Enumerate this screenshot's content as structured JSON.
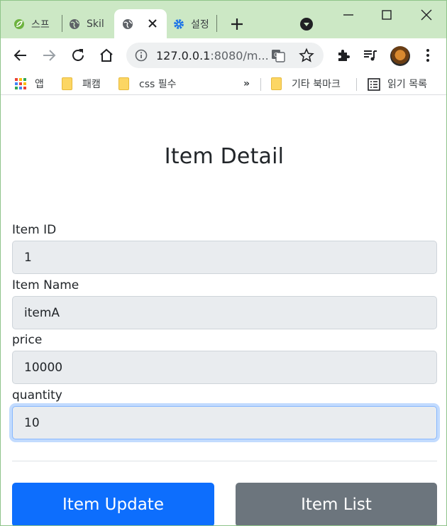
{
  "browser": {
    "tabs": [
      {
        "title": "스프",
        "active": false
      },
      {
        "title": "Skil",
        "active": false
      },
      {
        "title": "",
        "active": true
      },
      {
        "title": "설정",
        "active": false
      }
    ],
    "address": {
      "host": "127.0.0.1",
      "rest": ":8080/m..."
    },
    "bookmarks": [
      {
        "label": "앱",
        "icon": "apps-grid-icon"
      },
      {
        "label": "패캠",
        "icon": "folder-icon"
      },
      {
        "label": "css 필수",
        "icon": "folder-icon"
      },
      {
        "label": "기타 북마크",
        "icon": "folder-icon"
      },
      {
        "label": "읽기 목록",
        "icon": "reading-list-icon"
      }
    ],
    "overflow_label": "»"
  },
  "page": {
    "title": "Item Detail",
    "fields": [
      {
        "label": "Item ID",
        "value": "1"
      },
      {
        "label": "Item Name",
        "value": "itemA"
      },
      {
        "label": "price",
        "value": "10000"
      },
      {
        "label": "quantity",
        "value": "10"
      }
    ],
    "buttons": {
      "update": "Item Update",
      "list": "Item List"
    }
  },
  "colors": {
    "primary": "#0d6efd",
    "secondary": "#6c757d",
    "tabstrip": "#cce8c5",
    "field_bg": "#e9ecef"
  }
}
